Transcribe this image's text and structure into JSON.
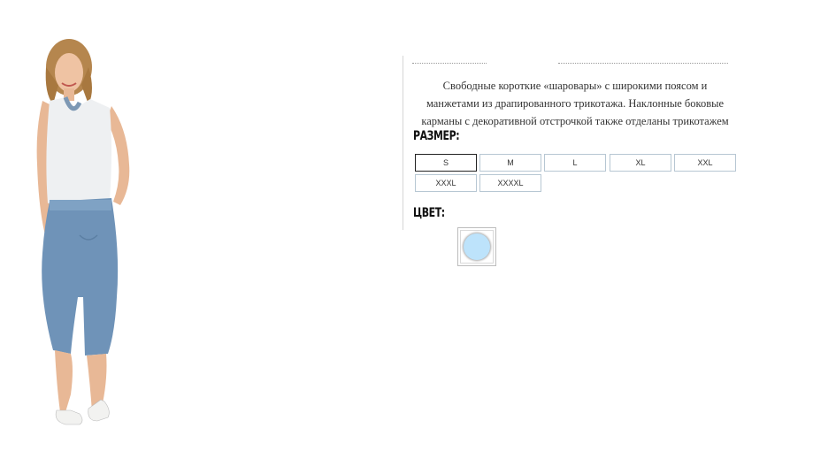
{
  "product": {
    "description": [
      "Свободные короткие «шаровары» с широкими поясом и",
      "манжетами из драпированного трикотажа. Наклонные боковые",
      "карманы с декоративной отстрочкой также отделаны трикотажем"
    ],
    "size_label": "РАЗМЕР:",
    "sizes": [
      "S",
      "M",
      "L",
      "XL",
      "XXL",
      "XXXL",
      "XXXXL"
    ],
    "selected_size": "S",
    "color_label": "ЦВЕТ:",
    "colors": [
      {
        "name": "light-blue",
        "hex": "#bde3fb"
      }
    ]
  },
  "palette": {
    "jeans": "#6f93b8",
    "top": "#eef0f2",
    "skin": "#e8b896",
    "hair": "#b5864e"
  }
}
